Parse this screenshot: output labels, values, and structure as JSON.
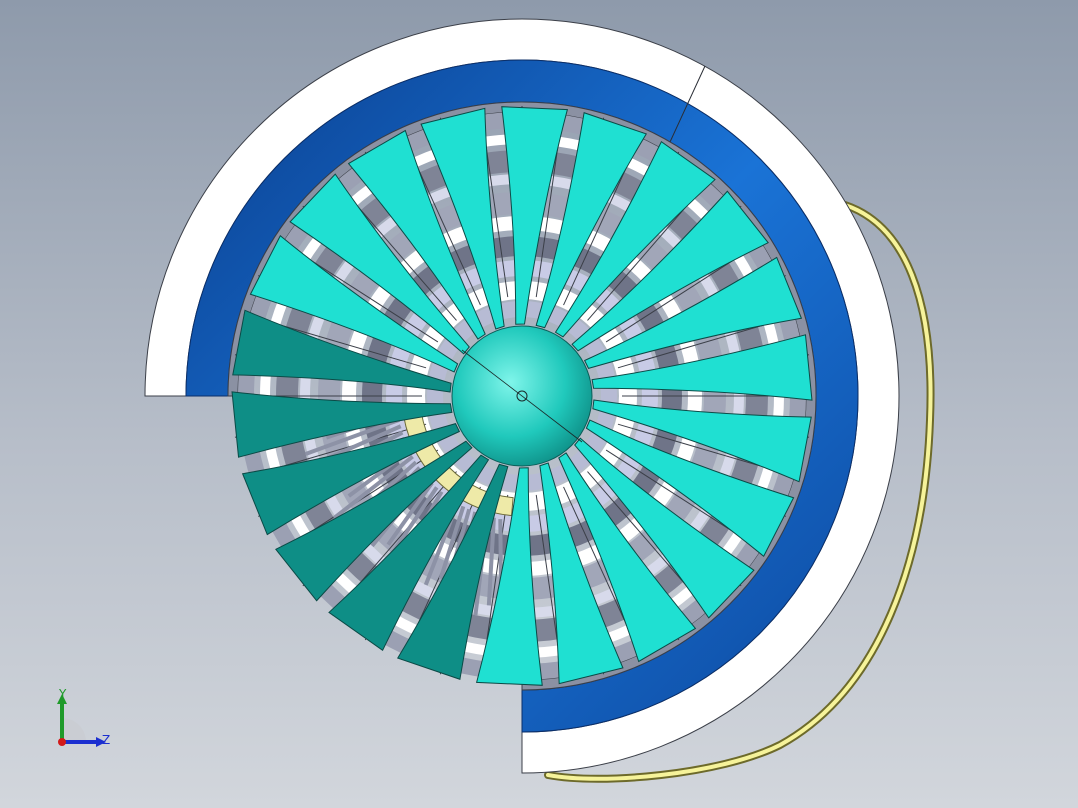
{
  "viewport": {
    "background_top": "#8e9aab",
    "background_bottom": "#d2d6dc"
  },
  "model": {
    "type": "turbofan-fan-assembly-section",
    "colors": {
      "outer_casing": "#ffffff",
      "nacelle_liner": "#1566c7",
      "fan_blade": "#1fe0d2",
      "fan_blade_shadow": "#0e8e86",
      "spinner": "#20c9bc",
      "stator_vane": "#9aa0b8",
      "stator_light": "#c8cbe6",
      "shaft_ring": "#eeeaa8",
      "harness_cable": "#f3f08a"
    },
    "fan_blade_count": 22
  },
  "triad": {
    "y_label": "Y",
    "z_label": "Z",
    "y_color": "#1f9a2a",
    "z_color": "#1b2fd0",
    "x_color": "#d21a1a"
  }
}
